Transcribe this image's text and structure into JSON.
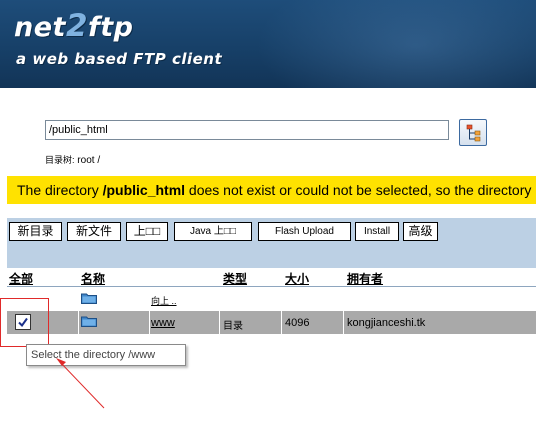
{
  "header": {
    "logo_prefix": "net",
    "logo_number": "2",
    "logo_suffix": "ftp",
    "tagline": "a web based FTP client"
  },
  "directory": {
    "value": "/public_html",
    "tree_button_icon": "tree-icon"
  },
  "breadcrumb": {
    "label": "目录树:",
    "root": "root",
    "separator": "/"
  },
  "warning": {
    "prefix": "The directory ",
    "path": "/public_html",
    "suffix": " does not exist or could not be selected, so the directory",
    "background": "#ffe200"
  },
  "toolbar": {
    "new_dir": "新目录",
    "new_file": "新文件",
    "upload": "上□□",
    "java_upload": "Java 上□□",
    "flash_upload": "Flash Upload",
    "install": "Install",
    "advanced": "高级"
  },
  "table": {
    "headers": {
      "all": "全部",
      "name": "名称",
      "type": "类型",
      "size": "大小",
      "owner": "拥有者"
    },
    "up_row": {
      "icon": "folder-icon",
      "label": "向上 .."
    },
    "rows": [
      {
        "icon": "folder-icon",
        "name": "www",
        "type": "目录",
        "size": "4096",
        "owner": "kongjianceshi.tk",
        "checked": true
      }
    ]
  },
  "tooltip": {
    "text": "Select the directory /www"
  },
  "colors": {
    "header": "#174068",
    "toolbar_bg": "#bcd0e4",
    "row_selected": "#a9a9a9",
    "annotation": "#e02a2a"
  }
}
